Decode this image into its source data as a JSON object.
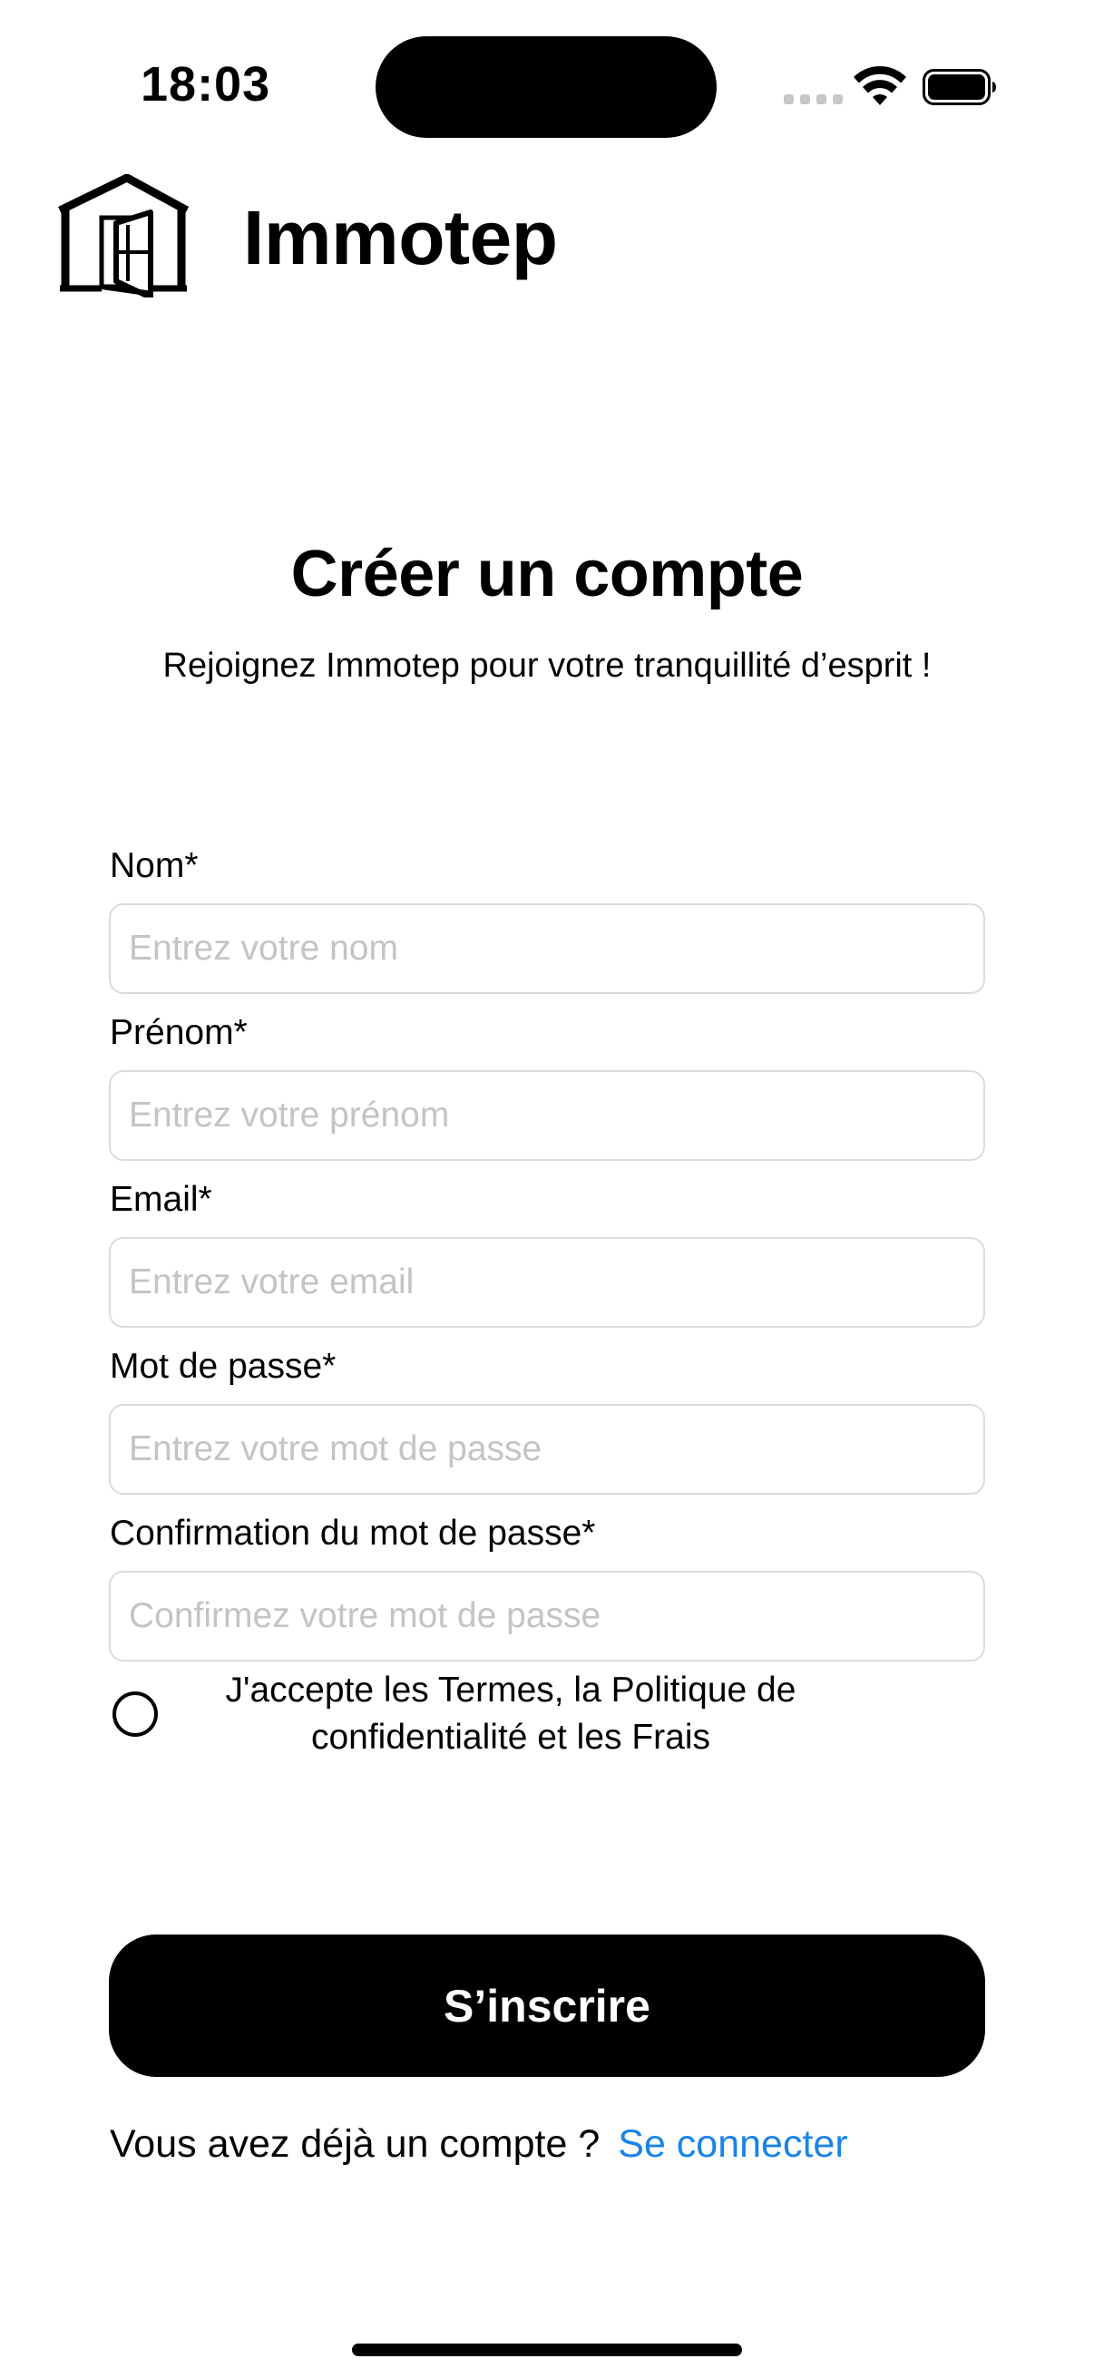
{
  "status_bar": {
    "time": "18:03"
  },
  "header": {
    "app_name": "Immotep",
    "logo_icon": "house-door-logo-icon"
  },
  "intro": {
    "title": "Créer un compte",
    "subtitle": "Rejoignez Immotep pour votre tranquillité d’esprit !"
  },
  "form": {
    "fields": [
      {
        "label": "Nom*",
        "placeholder": "Entrez votre nom",
        "value": ""
      },
      {
        "label": "Prénom*",
        "placeholder": "Entrez votre prénom",
        "value": ""
      },
      {
        "label": "Email*",
        "placeholder": "Entrez votre email",
        "value": ""
      },
      {
        "label": "Mot de passe*",
        "placeholder": "Entrez votre mot de passe",
        "value": ""
      },
      {
        "label": "Confirmation du mot de passe*",
        "placeholder": "Confirmez votre mot de passe",
        "value": ""
      }
    ],
    "terms": {
      "checked": false,
      "line1": "J'accepte les Termes, la Politique de",
      "line2": "confidentialité et les Frais"
    },
    "submit_label": "S’inscrire"
  },
  "footer": {
    "prompt": "Vous avez déjà un compte ?",
    "link": "Se connecter"
  },
  "colors": {
    "accent_link": "#1a84e8",
    "button_bg": "#000000",
    "placeholder": "#c4c4c6",
    "input_border": "#dcdcdc"
  }
}
